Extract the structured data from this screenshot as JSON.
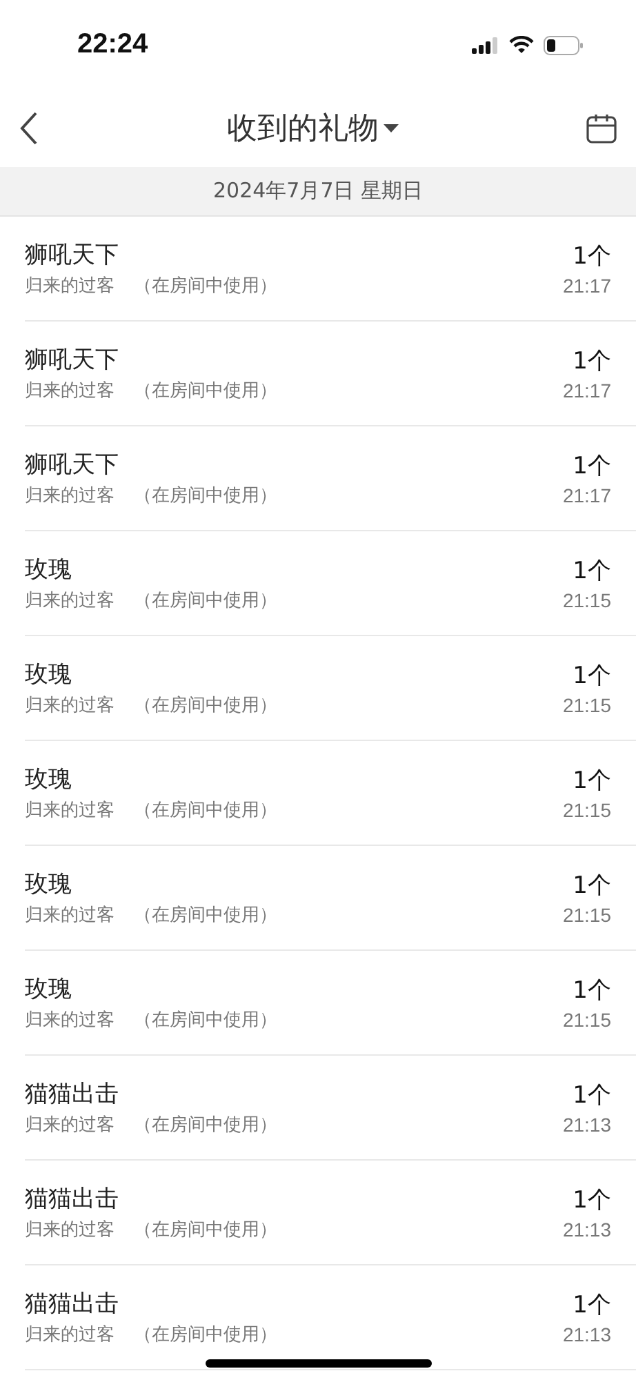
{
  "status_bar": {
    "time": "22:24"
  },
  "nav": {
    "title": "收到的礼物"
  },
  "date_header": "2024年7月7日 星期日",
  "gifts": [
    {
      "name": "狮吼天下",
      "sender": "归来的过客",
      "note": "（在房间中使用）",
      "count": "1个",
      "time": "21:17"
    },
    {
      "name": "狮吼天下",
      "sender": "归来的过客",
      "note": "（在房间中使用）",
      "count": "1个",
      "time": "21:17"
    },
    {
      "name": "狮吼天下",
      "sender": "归来的过客",
      "note": "（在房间中使用）",
      "count": "1个",
      "time": "21:17"
    },
    {
      "name": "玫瑰",
      "sender": "归来的过客",
      "note": "（在房间中使用）",
      "count": "1个",
      "time": "21:15"
    },
    {
      "name": "玫瑰",
      "sender": "归来的过客",
      "note": "（在房间中使用）",
      "count": "1个",
      "time": "21:15"
    },
    {
      "name": "玫瑰",
      "sender": "归来的过客",
      "note": "（在房间中使用）",
      "count": "1个",
      "time": "21:15"
    },
    {
      "name": "玫瑰",
      "sender": "归来的过客",
      "note": "（在房间中使用）",
      "count": "1个",
      "time": "21:15"
    },
    {
      "name": "玫瑰",
      "sender": "归来的过客",
      "note": "（在房间中使用）",
      "count": "1个",
      "time": "21:15"
    },
    {
      "name": "猫猫出击",
      "sender": "归来的过客",
      "note": "（在房间中使用）",
      "count": "1个",
      "time": "21:13"
    },
    {
      "name": "猫猫出击",
      "sender": "归来的过客",
      "note": "（在房间中使用）",
      "count": "1个",
      "time": "21:13"
    },
    {
      "name": "猫猫出击",
      "sender": "归来的过客",
      "note": "（在房间中使用）",
      "count": "1个",
      "time": "21:13"
    }
  ]
}
